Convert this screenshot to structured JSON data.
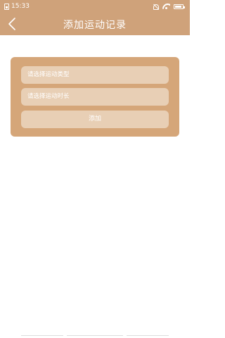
{
  "status_bar": {
    "time": "15:33"
  },
  "header": {
    "title": "添加运动记录",
    "background_color": "#cfa27a"
  },
  "form": {
    "type_placeholder": "请选择运动类型",
    "duration_placeholder": "请选择运动时长",
    "add_label": "添加",
    "card_color": "#d5a679",
    "field_color": "#e8cfb5"
  },
  "icons": {
    "status_left": "sim-icon",
    "status_right": [
      "bell-off-icon",
      "wifi-icon",
      "battery-icon"
    ],
    "back": "chevron-left-icon"
  }
}
